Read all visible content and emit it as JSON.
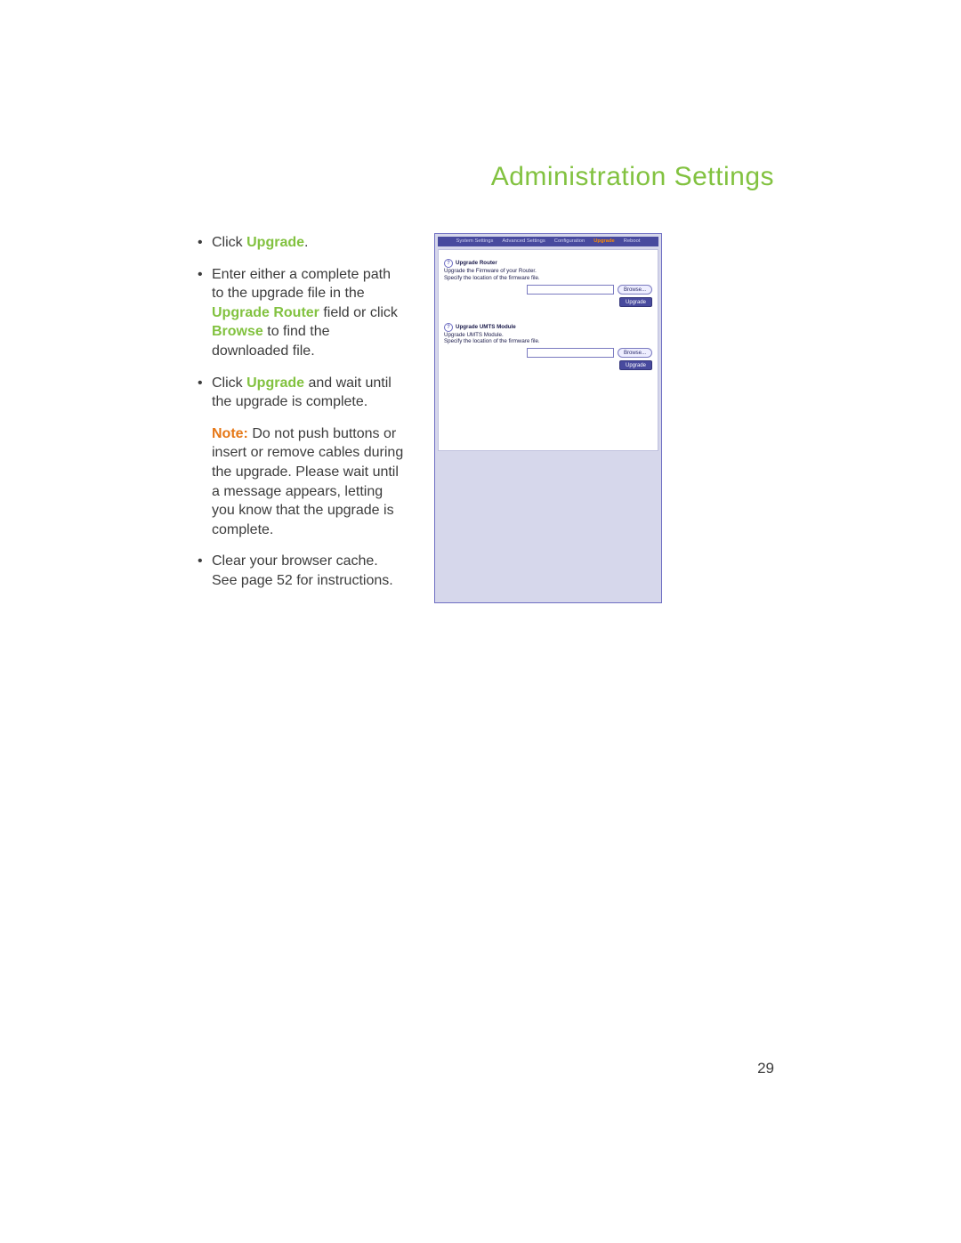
{
  "page": {
    "title": "Administration Settings",
    "number": "29"
  },
  "bullets": {
    "b1": {
      "prefix": "Click ",
      "upgrade": "Upgrade",
      "suffix": "."
    },
    "b2": {
      "l1": "Enter either a complete path to the upgrade file in the ",
      "field": "Upgrade Router",
      "l2": " field or click ",
      "browse": "Browse",
      "l3": " to find the downloaded file."
    },
    "b3": {
      "p1": "Click ",
      "upgrade": "Upgrade",
      "p2": " and wait until the upgrade is complete."
    },
    "note": {
      "label": "Note:",
      "text": " Do not push buttons or insert or remove cables during the upgrade. Please wait until a message appears, letting you know that the upgrade is complete."
    },
    "b4": "Clear your browser cache. See page 52 for instructions."
  },
  "router": {
    "tabs": {
      "t1": "System Settings",
      "t2": "Advanced Settings",
      "t3": "Configuration",
      "t4": "Upgrade",
      "t5": "Reboot"
    },
    "sec1": {
      "title": "Upgrade Router",
      "line1": "Upgrade the Firmware of your Router.",
      "line2": "Specify the location of the firmware file."
    },
    "sec2": {
      "title": "Upgrade UMTS Module",
      "line1": "Upgrade UMTS Module.",
      "line2": "Specify the location of the firmware file."
    },
    "buttons": {
      "browse": "Browse...",
      "upgrade": "Upgrade"
    },
    "help": "?"
  }
}
